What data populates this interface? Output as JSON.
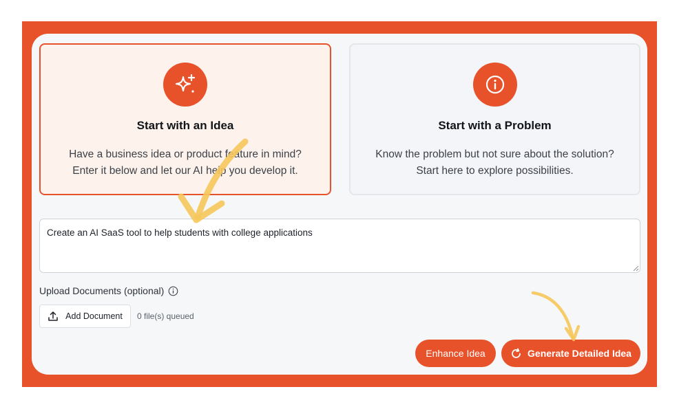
{
  "cards": [
    {
      "title": "Start with an Idea",
      "desc_line1": "Have a business idea or product feature in mind?",
      "desc_line2": "Enter it below and let our AI help you develop it.",
      "icon": "sparkles-icon",
      "selected": true
    },
    {
      "title": "Start with a Problem",
      "desc_line1": "Know the problem but not sure about the solution?",
      "desc_line2": "Start here to explore possibilities.",
      "icon": "info-icon",
      "selected": false
    }
  ],
  "idea_input": {
    "value": "Create an AI SaaS tool to help students with college applications"
  },
  "upload": {
    "label": "Upload Documents (optional)",
    "add_button_label": "Add Document",
    "queued_text": "0 file(s) queued"
  },
  "actions": {
    "enhance_label": "Enhance Idea",
    "generate_label": "Generate Detailed Idea"
  },
  "colors": {
    "accent": "#e8522b",
    "selected_card_bg": "#fdf3ec",
    "annotation_arrow": "#f6c65b"
  }
}
